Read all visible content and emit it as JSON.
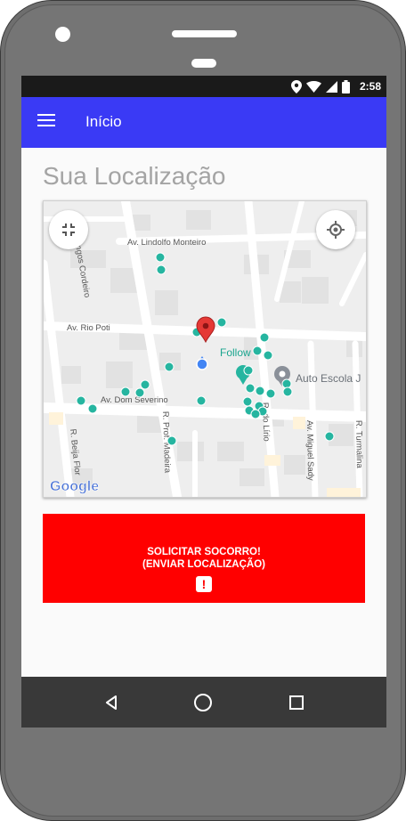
{
  "status_bar": {
    "time": "2:58",
    "icons": [
      "location-icon",
      "wifi-icon",
      "signal-icon",
      "battery-icon"
    ]
  },
  "app_bar": {
    "menu_icon": "hamburger-menu-icon",
    "title": "Início",
    "color": "#3a3af5"
  },
  "page": {
    "section_title": "Sua Localização"
  },
  "map": {
    "streets": {
      "lindolfo": "Av. Lindolfo Monteiro",
      "domingos": "R. Domingos Cordeiro",
      "rio_poti": "Av. Rio Poti",
      "dom_severino": "Av. Dom Severino",
      "beija_flor": "R. Beija Flor",
      "prof_madeira": "R. Prof. Madeira",
      "do_lirio": "R. do Lírio",
      "miguel_sady": "Av. Miguel Sady",
      "turmalina": "R. Turmalina"
    },
    "places": {
      "follow": "Follow",
      "autoescola": "Auto Escola J"
    },
    "logo": "Google",
    "exit_fullscreen_icon": "exit-fullscreen-icon",
    "my_location_icon": "my-location-icon",
    "marker_color": "#e53935",
    "point_color": "#26b5a0"
  },
  "sos_button": {
    "line1": "SOLICITAR SOCORRO!",
    "line2": "(ENVIAR LOCALIZAÇÃO)",
    "icon": "alert-icon",
    "icon_glyph": "!",
    "color": "#ff0000"
  },
  "nav_bar": {
    "back_icon": "back-icon",
    "home_icon": "home-icon",
    "recents_icon": "recents-icon"
  }
}
